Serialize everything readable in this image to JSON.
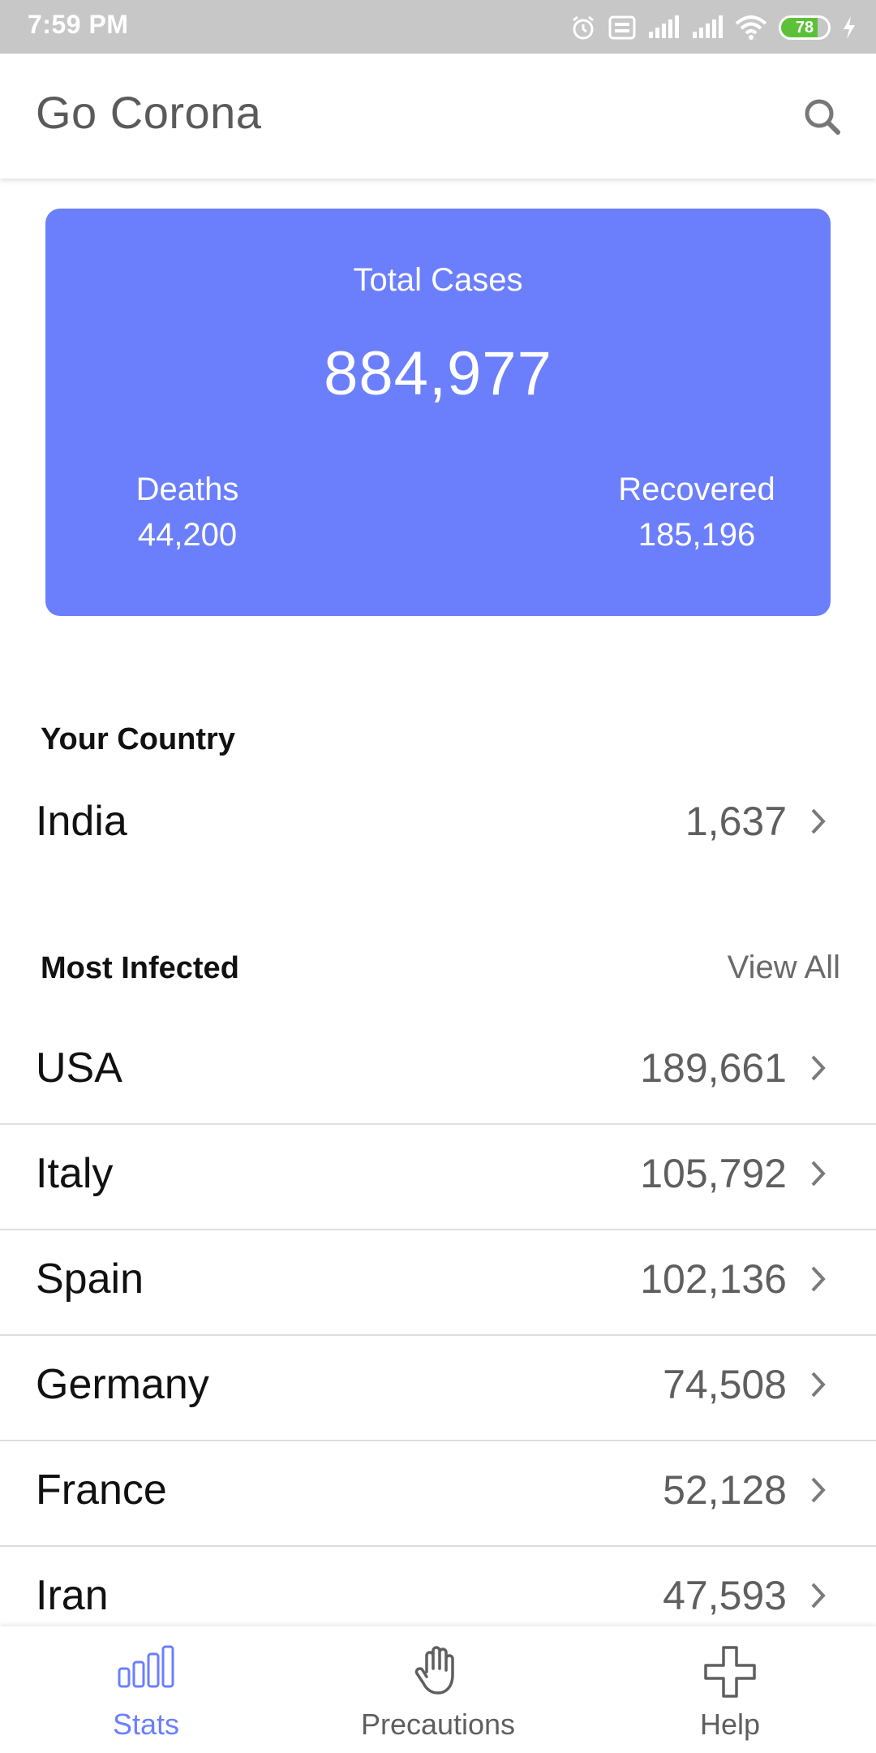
{
  "status_bar": {
    "time": "7:59 PM",
    "battery_level": 78,
    "icons": [
      "alarm-icon",
      "volte-icon",
      "signal-icon",
      "signal-icon",
      "wifi-icon",
      "battery-icon",
      "charging-icon"
    ]
  },
  "app_bar": {
    "title": "Go Corona",
    "search_icon": "search-icon"
  },
  "summary": {
    "total_label": "Total Cases",
    "total_value": "884,977",
    "deaths_label": "Deaths",
    "deaths_value": "44,200",
    "recovered_label": "Recovered",
    "recovered_value": "185,196",
    "card_color": "#6b7ffd"
  },
  "your_country": {
    "title": "Your Country",
    "name": "India",
    "count": "1,637"
  },
  "most_infected": {
    "title": "Most Infected",
    "view_all": "View All",
    "rows": [
      {
        "name": "USA",
        "count": "189,661"
      },
      {
        "name": "Italy",
        "count": "105,792"
      },
      {
        "name": "Spain",
        "count": "102,136"
      },
      {
        "name": "Germany",
        "count": "74,508"
      },
      {
        "name": "France",
        "count": "52,128"
      },
      {
        "name": "Iran",
        "count": "47,593"
      }
    ]
  },
  "bottom_nav": {
    "items": [
      {
        "label": "Stats",
        "icon": "bar-chart-icon",
        "active": true
      },
      {
        "label": "Precautions",
        "icon": "hand-icon",
        "active": false
      },
      {
        "label": "Help",
        "icon": "plus-icon",
        "active": false
      }
    ],
    "accent": "#6b7ffd"
  }
}
